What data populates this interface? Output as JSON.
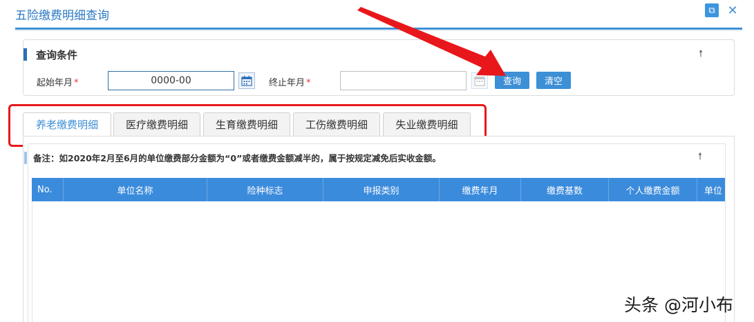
{
  "window": {
    "title": "五险缴费明细查询"
  },
  "query_panel": {
    "title": "查询条件",
    "start_label": "起始年月",
    "start_value": "0000-00",
    "end_label": "终止年月",
    "end_value": "",
    "required_mark": "*",
    "query_button": "查询",
    "clear_button": "清空"
  },
  "tabs": [
    {
      "label": "养老缴费明细",
      "active": true
    },
    {
      "label": "医疗缴费明细",
      "active": false
    },
    {
      "label": "生育缴费明细",
      "active": false
    },
    {
      "label": "工伤缴费明细",
      "active": false
    },
    {
      "label": "失业缴费明细",
      "active": false
    }
  ],
  "note": "备注：如2020年2月至6月的单位缴费部分金额为“0”或者缴费金额减半的，属于按规定减免后实收金额。",
  "table": {
    "columns": [
      "No.",
      "单位名称",
      "险种标志",
      "申报类别",
      "缴费年月",
      "缴费基数",
      "个人缴费金额",
      "单位"
    ]
  },
  "icons": {
    "expand": "external-link-icon",
    "close": "close-icon",
    "collapse": "arrow-up-icon",
    "calendar": "calendar-icon"
  },
  "colors": {
    "accent": "#3d8fd6",
    "header": "#3b8bdc",
    "annotation": "#e8171b"
  },
  "watermark": "头条 @河小布"
}
